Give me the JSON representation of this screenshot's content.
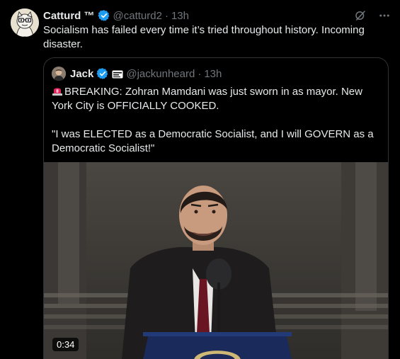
{
  "tweet": {
    "display_name": "Catturd ™",
    "handle": "@catturd2",
    "dot": "·",
    "time": "13h",
    "text": "Socialism has failed every time it’s tried throughout history. Incoming disaster."
  },
  "quote": {
    "display_name": "Jack",
    "handle": "@jackunheard",
    "dot": "·",
    "time": "13h",
    "line1": "BREAKING: Zohran Mamdani was just sworn in as mayor. New York City is OFFICIALLY COOKED.",
    "line2": "\"I was ELECTED as a Democratic Socialist, and I will GOVERN as a Democratic Socialist!\"",
    "video": {
      "duration": "0:34"
    }
  },
  "icons": {
    "verified": "verified-badge-icon",
    "grok": "grok-icon",
    "more": "more-icon",
    "affiliate": "affiliate-badge-icon",
    "siren": "siren-emoji-icon"
  },
  "colors": {
    "background": "#000000",
    "text": "#e7e9ea",
    "muted": "#71767b",
    "verified": "#1d9bf0",
    "border": "#2f3336"
  }
}
